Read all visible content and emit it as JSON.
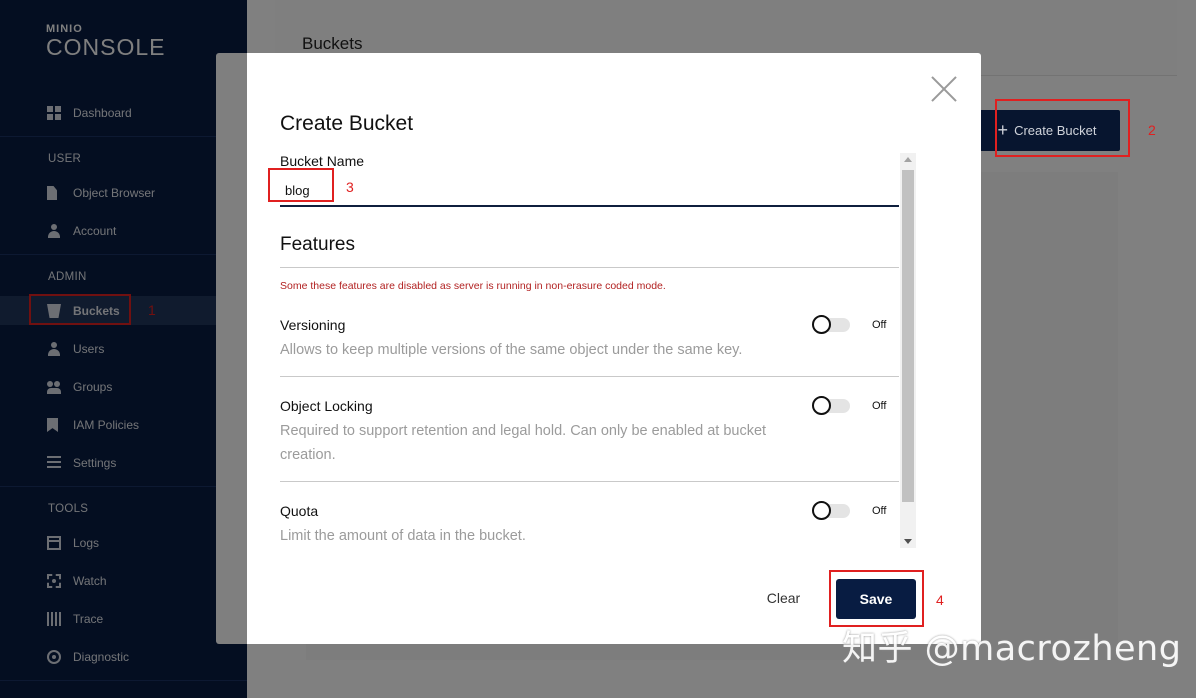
{
  "brand": {
    "small": "MINIO",
    "large": "CONSOLE"
  },
  "sidebar": {
    "items": [
      {
        "label": "Dashboard",
        "icon": "dashboard-icon"
      },
      {
        "section": "USER"
      },
      {
        "label": "Object Browser",
        "icon": "file-icon"
      },
      {
        "label": "Account",
        "icon": "account-icon"
      },
      {
        "section": "ADMIN"
      },
      {
        "label": "Buckets",
        "icon": "bucket-icon",
        "active": true
      },
      {
        "label": "Users",
        "icon": "user-icon"
      },
      {
        "label": "Groups",
        "icon": "groups-icon"
      },
      {
        "label": "IAM Policies",
        "icon": "policy-icon"
      },
      {
        "label": "Settings",
        "icon": "settings-icon"
      },
      {
        "section": "TOOLS"
      },
      {
        "label": "Logs",
        "icon": "logs-icon"
      },
      {
        "label": "Watch",
        "icon": "watch-icon"
      },
      {
        "label": "Trace",
        "icon": "trace-icon"
      },
      {
        "label": "Diagnostic",
        "icon": "diagnostic-icon"
      }
    ]
  },
  "page": {
    "title": "Buckets",
    "create_button": "Create Bucket",
    "create_icon": "+"
  },
  "modal": {
    "title": "Create Bucket",
    "bucket_name_label": "Bucket Name",
    "bucket_name_value": "blog",
    "features_title": "Features",
    "warning": "Some these features are disabled as server is running in non-erasure coded mode.",
    "features": [
      {
        "name": "Versioning",
        "description": "Allows to keep multiple versions of the same object under the same key.",
        "state": "Off"
      },
      {
        "name": "Object Locking",
        "description": "Required to support retention and legal hold. Can only be enabled at bucket creation.",
        "state": "Off"
      },
      {
        "name": "Quota",
        "description": "Limit the amount of data in the bucket.",
        "state": "Off"
      }
    ],
    "clear_button": "Clear",
    "save_button": "Save"
  },
  "annotations": {
    "n1": "1",
    "n2": "2",
    "n3": "3",
    "n4": "4"
  },
  "watermark": "知乎 @macrozheng",
  "colors": {
    "sidebar_bg": "#081c42",
    "primary_button": "#081c42",
    "annotation": "#e02020",
    "warning": "#b22222"
  }
}
